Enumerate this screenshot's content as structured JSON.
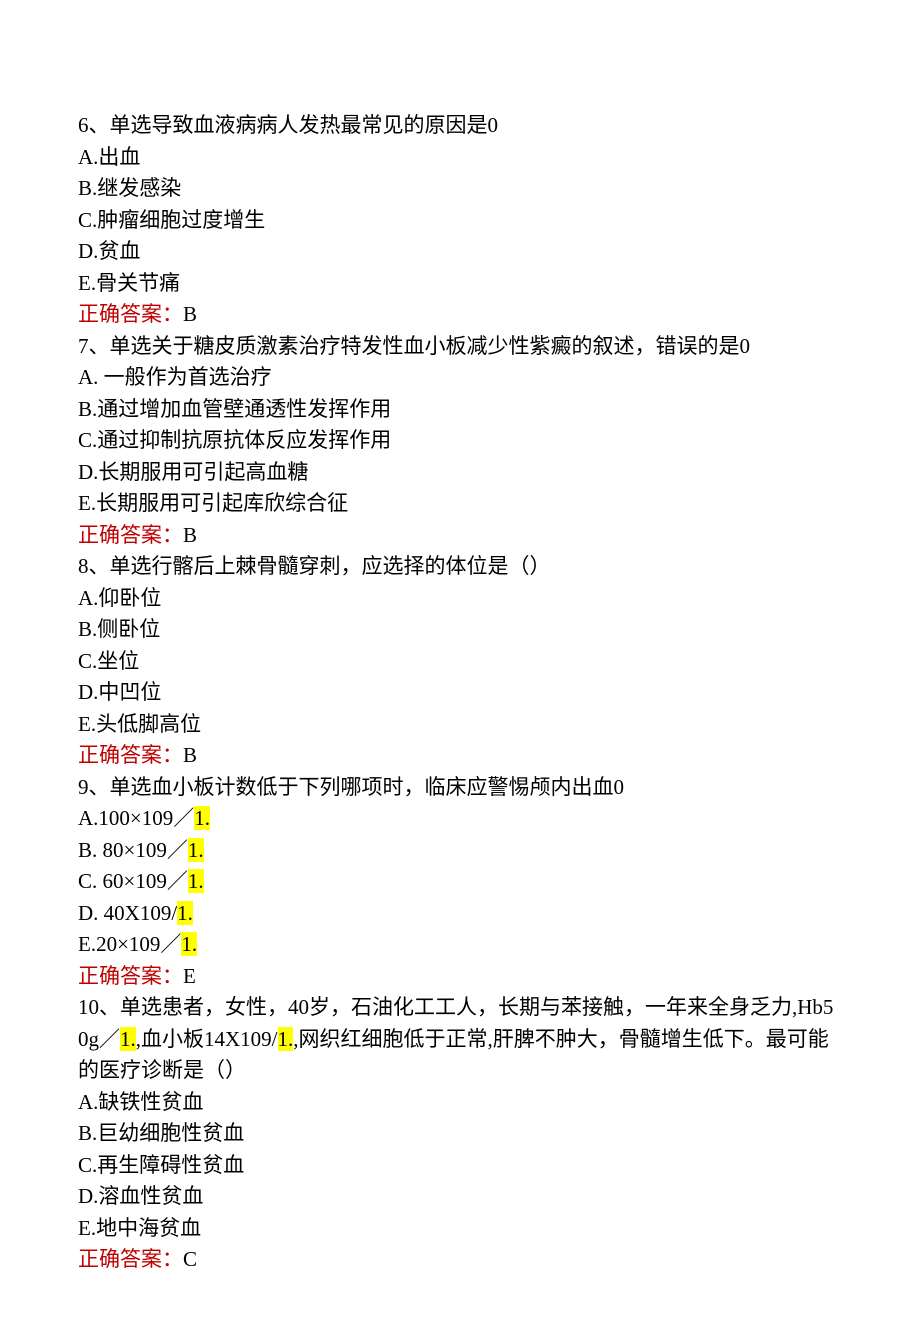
{
  "q6": {
    "stem": "6、单选导致血液病病人发热最常见的原因是0",
    "opts": {
      "A": "A.出血",
      "B": "B.继发感染",
      "C": "C.肿瘤细胞过度增生",
      "D": "D.贫血",
      "E": "E.骨关节痛"
    },
    "ans_label": "正确答案：",
    "ans_value": "B"
  },
  "q7": {
    "stem": "7、单选关于糖皮质激素治疗特发性血小板减少性紫癜的叙述，错误的是0",
    "opts": {
      "A": "A. 一般作为首选治疗",
      "B": "B.通过增加血管壁通透性发挥作用",
      "C": "C.通过抑制抗原抗体反应发挥作用",
      "D": "D.长期服用可引起高血糖",
      "E": "E.长期服用可引起库欣综合征"
    },
    "ans_label": "正确答案：",
    "ans_value": "B"
  },
  "q8": {
    "stem": "8、单选行髂后上棘骨髓穿刺，应选择的体位是（）",
    "opts": {
      "A": "A.仰卧位",
      "B": "B.侧卧位",
      "C": "C.坐位",
      "D": "D.中凹位",
      "E": "E.头低脚高位"
    },
    "ans_label": "正确答案：",
    "ans_value": "B"
  },
  "q9": {
    "stem": "9、单选血小板计数低于下列哪项时，临床应警惕颅内出血0",
    "opts": {
      "A_pre": "A.100×109／",
      "A_hl": "1.",
      "B_pre": "B. 80×109／",
      "B_hl": "1.",
      "C_pre": "C. 60×109／",
      "C_hl": "1.",
      "D_pre": "D. 40X109/",
      "D_hl": "1.",
      "E_pre": "E.20×109／",
      "E_hl": "1."
    },
    "ans_label": "正确答案：",
    "ans_value": "E"
  },
  "q10": {
    "stem_p1": "10、单选患者，女性，40岁，石油化工工人，长期与苯接触，一年来全身乏力,Hb50g／",
    "stem_hl1": "1.",
    "stem_p2": ",血小板14X109/",
    "stem_hl2": "1.",
    "stem_p3": ",网织红细胞低于正常,肝脾不肿大，骨髓增生低下。最可能的医疗诊断是（）",
    "opts": {
      "A": "A.缺铁性贫血",
      "B": "B.巨幼细胞性贫血",
      "C": "C.再生障碍性贫血",
      "D": "D.溶血性贫血",
      "E": "E.地中海贫血"
    },
    "ans_label": "正确答案：",
    "ans_value": "C"
  }
}
